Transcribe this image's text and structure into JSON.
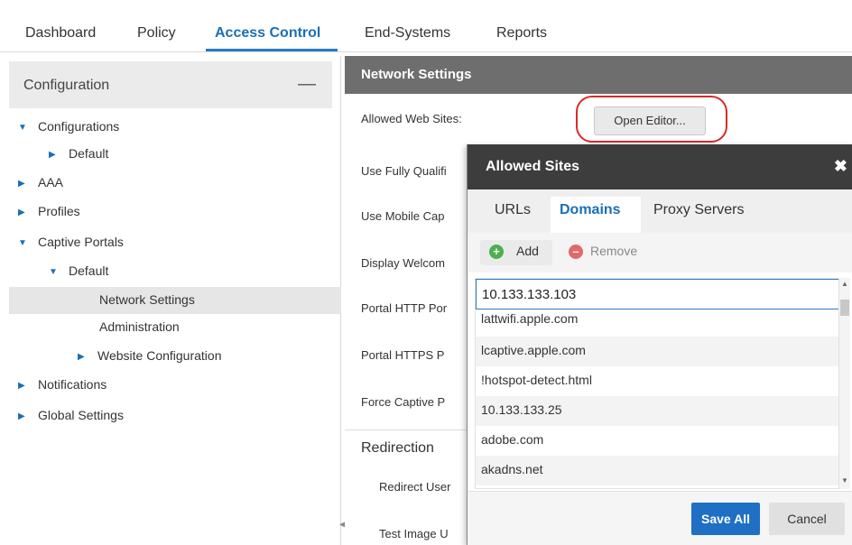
{
  "topnav": {
    "tabs": [
      "Dashboard",
      "Policy",
      "Access Control",
      "End-Systems",
      "Reports"
    ],
    "active": "Access Control"
  },
  "left": {
    "header": "Configuration",
    "collapse_glyph": "—",
    "tree": [
      {
        "label": "Configurations",
        "expanded": true
      },
      {
        "label": "Default",
        "expanded": false
      },
      {
        "label": "AAA",
        "expanded": false
      },
      {
        "label": "Profiles",
        "expanded": false
      },
      {
        "label": "Captive Portals",
        "expanded": true
      },
      {
        "label": "Default",
        "expanded": true
      },
      {
        "label": "Network Settings",
        "selected": true
      },
      {
        "label": "Administration"
      },
      {
        "label": "Website Configuration",
        "expanded": false
      },
      {
        "label": "Notifications",
        "expanded": false
      },
      {
        "label": "Global Settings",
        "expanded": false
      }
    ]
  },
  "content": {
    "header": "Network Settings",
    "fields": [
      "Allowed Web Sites:",
      "Use Fully Qualifi",
      "Use Mobile Cap",
      "Display Welcom",
      "Portal HTTP Por",
      "Portal HTTPS P",
      "Force Captive P"
    ],
    "open_editor": "Open Editor...",
    "redirection": "Redirection",
    "redirect_user": "Redirect User",
    "test_image": "Test Image U"
  },
  "dialog": {
    "title": "Allowed Sites",
    "close": "✖",
    "tabs": [
      "URLs",
      "Domains",
      "Proxy Servers"
    ],
    "active_tab": "Domains",
    "add": "Add",
    "remove": "Remove",
    "input_value": "10.133.133.103",
    "rows": [
      "lattwifi.apple.com",
      "lcaptive.apple.com",
      "!hotspot-detect.html",
      "10.133.133.25",
      "adobe.com",
      "akadns.net"
    ],
    "save": "Save All",
    "cancel": "Cancel"
  },
  "colors": {
    "accent": "#1a6fb5",
    "header_gray": "#6e6e6e",
    "dialog_header": "#3d3d3d",
    "highlight": "#d92a2a",
    "save_button": "#1f6fc4"
  }
}
